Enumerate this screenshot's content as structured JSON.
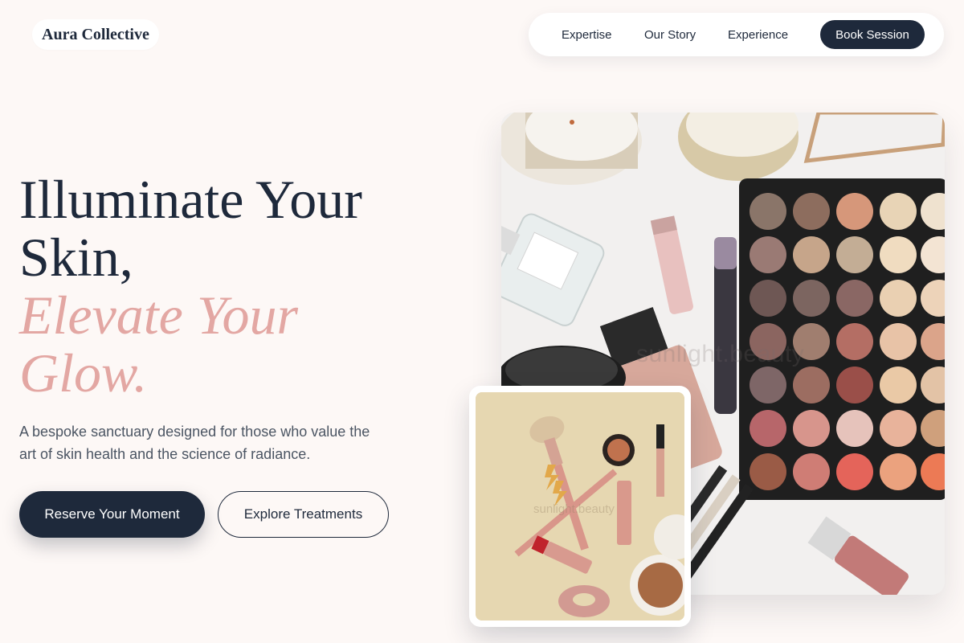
{
  "brand": {
    "name": "Aura Collective"
  },
  "nav": {
    "links": [
      "Expertise",
      "Our Story",
      "Experience"
    ],
    "cta": "Book Session"
  },
  "hero": {
    "headline_line1": "Illuminate Your",
    "headline_line2": "Skin,",
    "accent_line1": "Elevate Your",
    "accent_line2": "Glow.",
    "subtitle": "A bespoke sanctuary designed for those who value the art of skin health and the science of radiance.",
    "primary_cta": "Reserve Your Moment",
    "secondary_cta": "Explore Treatments"
  },
  "images": {
    "main_watermark": "sunlight.beauty",
    "card_watermark": "sunlight.beauty"
  },
  "colors": {
    "background": "#fdf8f6",
    "navy": "#1e293b",
    "accent_pink": "#e3a7a3",
    "body_text": "#4b5563"
  }
}
